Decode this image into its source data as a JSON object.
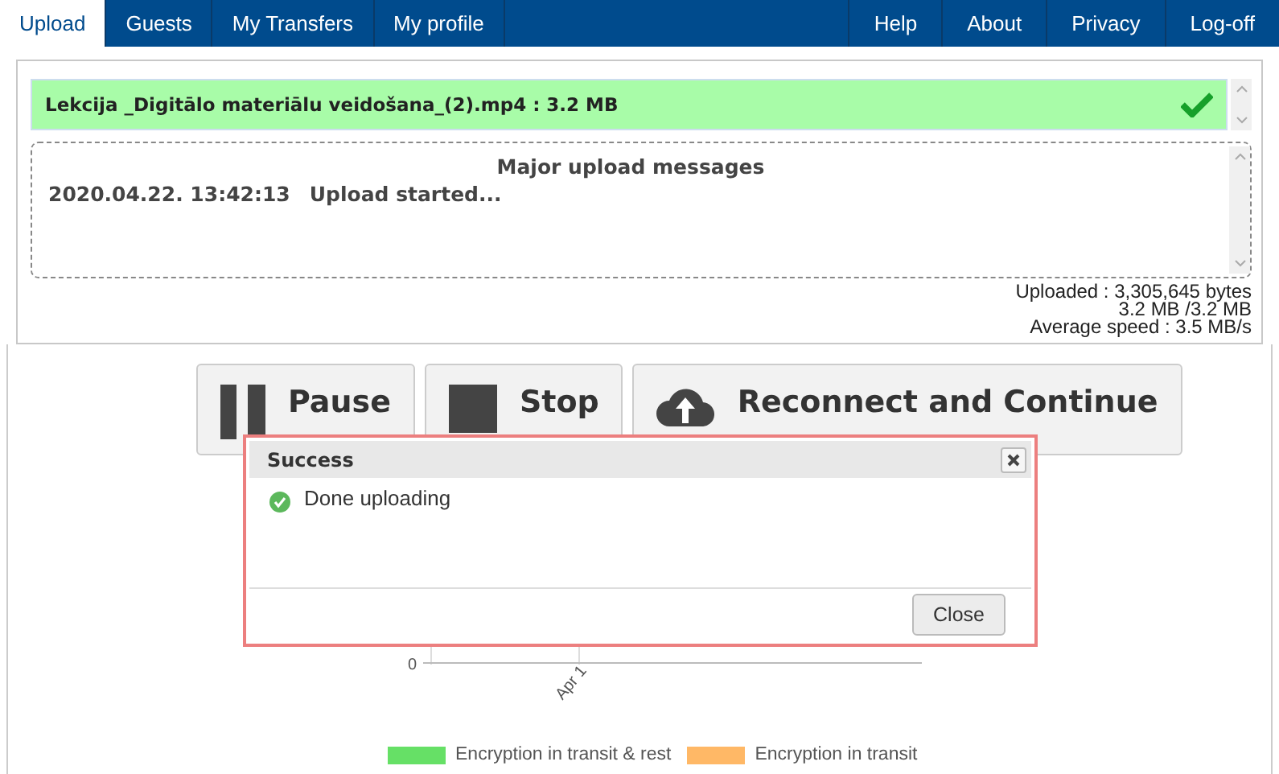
{
  "nav": {
    "left_tabs": [
      {
        "label": "Upload",
        "selected": true
      },
      {
        "label": "Guests",
        "selected": false
      },
      {
        "label": "My Transfers",
        "selected": false
      },
      {
        "label": "My profile",
        "selected": false
      }
    ],
    "right_tabs": [
      {
        "label": "Help",
        "selected": false
      },
      {
        "label": "About",
        "selected": false
      },
      {
        "label": "Privacy",
        "selected": false
      },
      {
        "label": "Log-off",
        "selected": false
      }
    ]
  },
  "file": {
    "name": "Lekcija _Digitālo materiālu veidošana_(2).mp4 : 3.2 MB",
    "done": true
  },
  "messages": {
    "title": "Major upload messages",
    "entries": [
      {
        "time": "2020.04.22. 13:42:13",
        "text": "Upload started..."
      }
    ]
  },
  "stats": [
    "Uploaded : 3,305,645 bytes",
    "3.2 MB /3.2 MB",
    "Average speed : 3.5 MB/s"
  ],
  "controls": [
    {
      "kind": "pause",
      "label": "Pause"
    },
    {
      "kind": "stop",
      "label": "Stop"
    },
    {
      "kind": "reconnect",
      "label": "Reconnect and Continue"
    }
  ],
  "chart": {
    "y_tick": "0",
    "x_tick": "Apr 1",
    "legend": [
      {
        "label": "Encryption in transit & rest",
        "color": "#66e066"
      },
      {
        "label": "Encryption in transit",
        "color": "#ffb866"
      }
    ]
  },
  "dialog": {
    "title": "Success",
    "message": "Done uploading",
    "button": "Close"
  }
}
